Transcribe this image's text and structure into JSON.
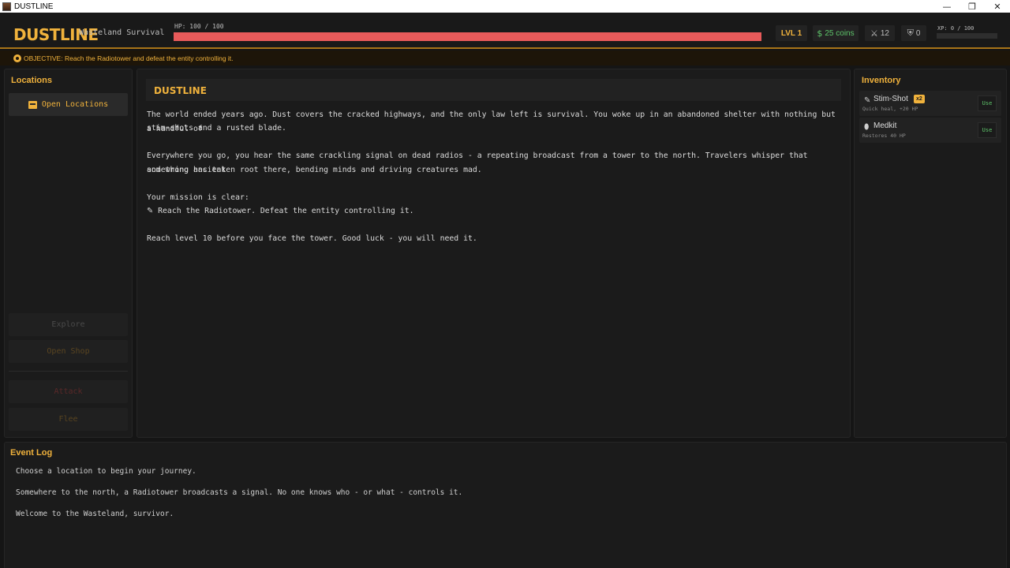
{
  "window": {
    "title": "DUSTLINE",
    "minimize": "—",
    "restore": "❐",
    "close": "✕"
  },
  "header": {
    "brand": "DUSTLINE",
    "subtitle": "Wasteland Survival",
    "hp_label": "HP: 100 / 100",
    "hp_fraction": 1.0,
    "level": "LVL 1",
    "coins": "25 coins",
    "attack": "12",
    "defense": "0",
    "xp_label": "XP: 0 / 100",
    "xp_fraction": 0.0,
    "colors": {
      "accent": "#f0b23c",
      "hp": "#e85a5a",
      "coins": "#5ec46a"
    }
  },
  "objective": {
    "text": "OBJECTIVE: Reach the Radiotower and defeat the entity controlling it."
  },
  "left_panel": {
    "title": "Locations",
    "open_locations": "Open Locations",
    "explore": "Explore",
    "open_shop": "Open Shop",
    "attack": "Attack",
    "flee": "Flee"
  },
  "scene": {
    "title": "DUSTLINE",
    "lines": [
      "The world ended years ago. Dust covers the cracked highways, and the only law left is survival. You woke up in an abandoned shelter with nothing but a handful of",
      "stim-shots and a rusted blade.",
      "Everywhere you go, you hear the same crackling signal on dead radios - a repeating broadcast from a tower to the north. Travelers whisper that something ancient",
      "and wrong has taken root there, bending minds and driving creatures mad.",
      "Your mission is clear:",
      "Reach the Radiotower. Defeat the entity controlling it.",
      "Reach level 10 before you face the tower. Good luck - you will need it."
    ]
  },
  "inventory": {
    "title": "Inventory",
    "items": [
      {
        "name": "Stim-Shot",
        "qty": "x2",
        "desc": "Quick heal, +20 HP",
        "use": "Use",
        "icon": "syringe-icon"
      },
      {
        "name": "Medkit",
        "desc": "Restores 40 HP",
        "use": "Use",
        "icon": "pill-icon"
      }
    ]
  },
  "event_log": {
    "title": "Event Log",
    "lines": [
      "Choose a location to begin your journey.",
      "Somewhere to the north, a Radiotower broadcasts a signal. No one knows who - or what - controls it.",
      "Welcome to the Wasteland, survivor."
    ]
  }
}
